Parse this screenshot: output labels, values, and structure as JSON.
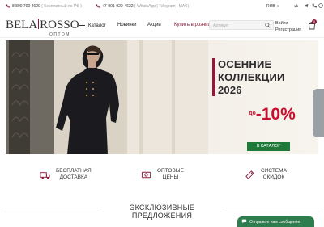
{
  "topbar": {
    "phone1": "8 800 700 4620",
    "phone1_note": "( Бесплатный по РФ )",
    "phone2": "+7-901-929-4622",
    "phone2_note": "( WhatsApp | Telegram | MAX)",
    "language": "RUB",
    "social_icons": [
      "vk-icon",
      "telegram-icon",
      "phone-icon",
      "whatsapp-icon"
    ]
  },
  "header": {
    "logo_part1": "BELA",
    "logo_part2": "ROSSO",
    "logo_sub": "ОПТОМ",
    "catalog_label": "Каталог",
    "nav": [
      {
        "label": "Новинки"
      },
      {
        "label": "Акции"
      }
    ],
    "retail_label": "Купить в розницу",
    "search_placeholder": "Артикул",
    "auth": {
      "login": "Войти",
      "register": "Регистрация"
    },
    "cart_count": "0"
  },
  "banner": {
    "title_line1": "ОСЕННИЕ",
    "title_line2": "КОЛЛЕКЦИИ",
    "title_line3": "2026",
    "discount_prefix": "до",
    "discount_value": "-10%",
    "cta_label": "В КАТАЛОГ",
    "accent_color": "#8b1a3a",
    "discount_color": "#c8102e",
    "cta_color": "#1f7a3a"
  },
  "features": [
    {
      "icon": "truck-icon",
      "line1": "БЕСПЛАТНАЯ",
      "line2": "ДОСТАВКА"
    },
    {
      "icon": "price-tag-icon",
      "line1": "ОПТОВЫЕ",
      "line2": "ЦЕНЫ"
    },
    {
      "icon": "discount-icon",
      "line1": "СИСТЕМА",
      "line2": "СКИДОК"
    }
  ],
  "exclusive_title": "ЭКСКЛЮЗИВНЫЕ ПРЕДЛОЖЕНИЯ",
  "chat": {
    "label": "Отправьте нам сообщение"
  }
}
